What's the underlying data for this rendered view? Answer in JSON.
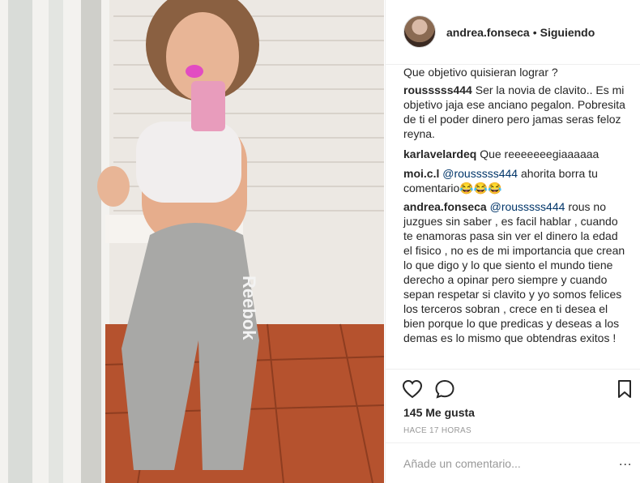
{
  "post": {
    "username": "andrea.fonseca",
    "separator": "•",
    "follow_status": "Siguiendo",
    "caption": "Que objetivo quisieran lograr ?",
    "likes": "145 Me gusta",
    "time_ago": "HACE 17 HORAS",
    "add_comment_placeholder": "Añade un comentario...",
    "more_options": "...",
    "photo_brand_text": "Reebok"
  },
  "comments": [
    {
      "username": "rousssss444",
      "text": "Ser la novia de clavito.. Es mi objetivo jaja ese anciano pegalon. Pobresita de ti el poder dinero pero jamas seras feloz reyna."
    },
    {
      "username": "karlavelardeq",
      "text": "Que reeeeeeegiaaaaaa"
    },
    {
      "username": "moi.c.l",
      "mention": "@rousssss444",
      "text": "ahorita borra tu comentario😂😂😂"
    },
    {
      "username": "andrea.fonseca",
      "mention": "@rousssss444",
      "text": "rous no juzgues sin saber , es facil hablar , cuando te enamoras pasa sin ver el dinero la edad el fisico , no es de mi importancia que crean lo que digo y lo que siento el mundo tiene derecho a opinar pero siempre y cuando sepan respetar si clavito y yo somos felices los terceros sobran , crece en ti desea el bien porque lo que predicas y deseas a los demas es lo mismo que obtendras exitos !"
    }
  ],
  "colors": {
    "text": "#262626",
    "mention": "#003569",
    "muted": "#999999",
    "border": "#efefef"
  },
  "icons": [
    "heart-icon",
    "comment-icon",
    "bookmark-icon"
  ]
}
